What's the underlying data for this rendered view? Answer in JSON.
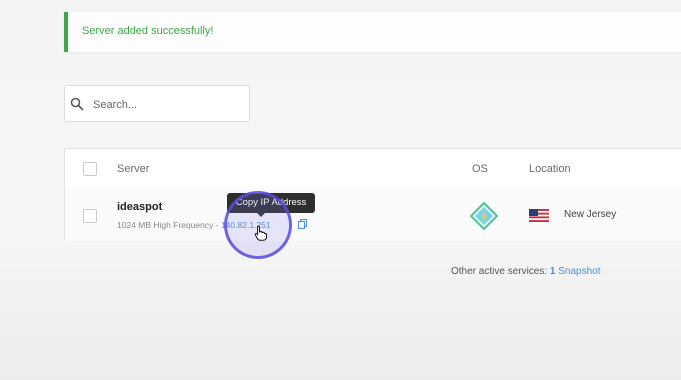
{
  "alert": {
    "message": "Server added successfully!"
  },
  "search": {
    "placeholder": "Search..."
  },
  "table": {
    "columns": {
      "server": "Server",
      "os": "OS",
      "location": "Location"
    },
    "rows": [
      {
        "name": "ideaspot",
        "plan": "1024 MB High Frequency - ",
        "ip": "140.82.1.251",
        "location": "New Jersey"
      }
    ]
  },
  "tooltip": {
    "text": "Copy IP Address"
  },
  "footer": {
    "label": "Other active services: ",
    "count": "1",
    "link": "Snapshot"
  },
  "colors": {
    "success": "#3fa54a",
    "link": "#4a8fd4",
    "cursor_ring": "#584cdc"
  },
  "icons": [
    "search-icon",
    "copy-icon",
    "os-logo-icon",
    "us-flag-icon",
    "hand-cursor-icon"
  ]
}
